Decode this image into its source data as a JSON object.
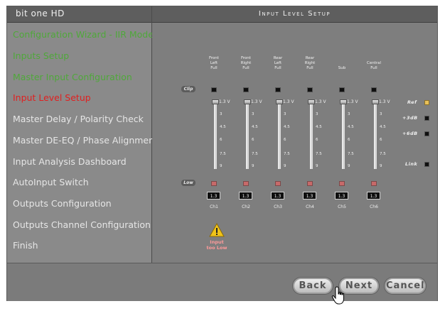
{
  "app_title": "bit one HD",
  "page_title": "Input Level Setup",
  "sidebar": {
    "items": [
      {
        "label": "Configuration Wizard - IIR Mode",
        "color": "#4fa83a"
      },
      {
        "label": "Inputs Setup",
        "color": "#4fa83a"
      },
      {
        "label": "Master Input Configuration",
        "color": "#4fa83a"
      },
      {
        "label": "Input Level Setup",
        "color": "#e02020"
      },
      {
        "label": "Master Delay / Polarity Check",
        "color": "#e6e6e6"
      },
      {
        "label": "Master DE-EQ / Phase Alignment",
        "color": "#e6e6e6"
      },
      {
        "label": "Input Analysis Dashboard",
        "color": "#e6e6e6"
      },
      {
        "label": "AutoInput Switch",
        "color": "#e6e6e6"
      },
      {
        "label": "Outputs Configuration",
        "color": "#e6e6e6"
      },
      {
        "label": "Outputs Channel Configuration",
        "color": "#e6e6e6"
      },
      {
        "label": "Finish",
        "color": "#e6e6e6"
      }
    ]
  },
  "rows": {
    "clip_label": "Clip",
    "low_label": "Low"
  },
  "channels": [
    {
      "header": [
        "Front",
        "Left",
        "Full"
      ],
      "top": "1.3 V",
      "ticks": [
        "3",
        "4.5",
        "6",
        "7.5",
        "9"
      ],
      "value": "1.3",
      "name": "Ch1"
    },
    {
      "header": [
        "Front",
        "Right",
        "Full"
      ],
      "top": "1.3 V",
      "ticks": [
        "3",
        "4.5",
        "6",
        "7.5",
        "9"
      ],
      "value": "1.3",
      "name": "Ch2"
    },
    {
      "header": [
        "Rear",
        "Left",
        "Full"
      ],
      "top": "1.3 V",
      "ticks": [
        "3",
        "4.5",
        "6",
        "7.5",
        "9"
      ],
      "value": "1.3",
      "name": "Ch3"
    },
    {
      "header": [
        "Rear",
        "Right",
        "Full"
      ],
      "top": "1.3 V",
      "ticks": [
        "3",
        "4.5",
        "6",
        "7.5",
        "9"
      ],
      "value": "1.3",
      "name": "Ch4"
    },
    {
      "header": [
        "Sub",
        "",
        ""
      ],
      "top": "1.3 V",
      "ticks": [
        "3",
        "4.5",
        "6",
        "7.5",
        "9"
      ],
      "value": "1.3",
      "name": "Ch5"
    },
    {
      "header": [
        "Central",
        "Full",
        ""
      ],
      "top": "1.3 V",
      "ticks": [
        "3",
        "4.5",
        "6",
        "7.5",
        "9"
      ],
      "value": "1.3",
      "name": "Ch6"
    }
  ],
  "side_indicators": {
    "ref": "Ref",
    "plus3": "+3dB",
    "plus6": "+6dB",
    "link": "Link"
  },
  "warning": {
    "line1": "Input",
    "line2": "too Low",
    "text_color": "#ff9a9a",
    "icon": "warning-triangle-icon"
  },
  "buttons": {
    "back": "Back",
    "next": "Next",
    "cancel": "Cancel"
  },
  "accent": {
    "ref_led": "#e8c15a",
    "low_led": "#c76a6a"
  }
}
